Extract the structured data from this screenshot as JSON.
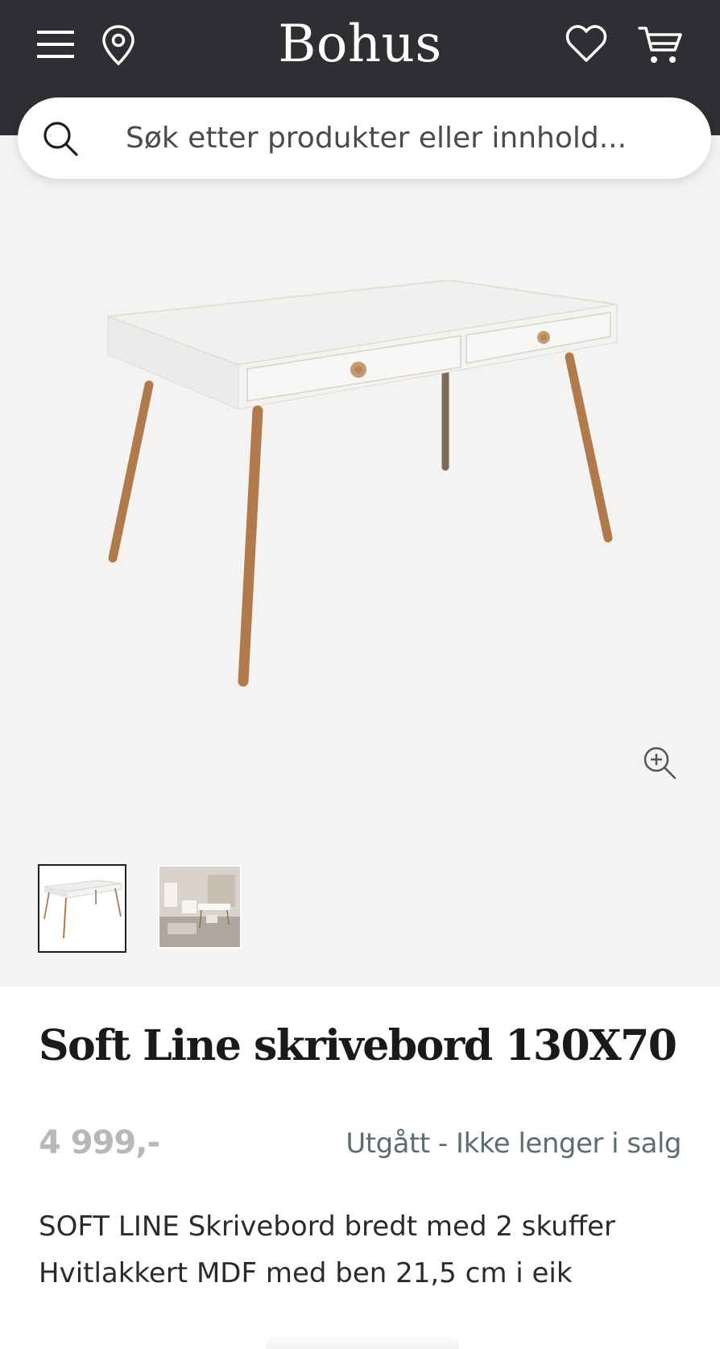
{
  "header": {
    "brand": "Bohus",
    "background_color": "#2f2f33",
    "icons": [
      "menu-icon",
      "location-pin-icon",
      "heart-icon",
      "cart-icon"
    ]
  },
  "search": {
    "placeholder": "Søk etter produkter eller innhold...",
    "value": ""
  },
  "gallery": {
    "main_image": "white-desk-with-oak-legs",
    "thumbnails": [
      "desk-product-photo",
      "desk-room-photo"
    ],
    "selected_thumbnail": 1
  },
  "product": {
    "title": "Soft Line skrivebord 130X70",
    "price": "4 999,-",
    "status": "Utgått - Ikke lenger i salg",
    "description": [
      "SOFT LINE Skrivebord bredt med 2 skuffer",
      "Hvitlakkert MDF med ben 21,5 cm i eik"
    ]
  },
  "colors": {
    "gallery_bg": "#f5f3f2",
    "status_text": "#5c6e74",
    "price_text": "#b8b8b8"
  }
}
